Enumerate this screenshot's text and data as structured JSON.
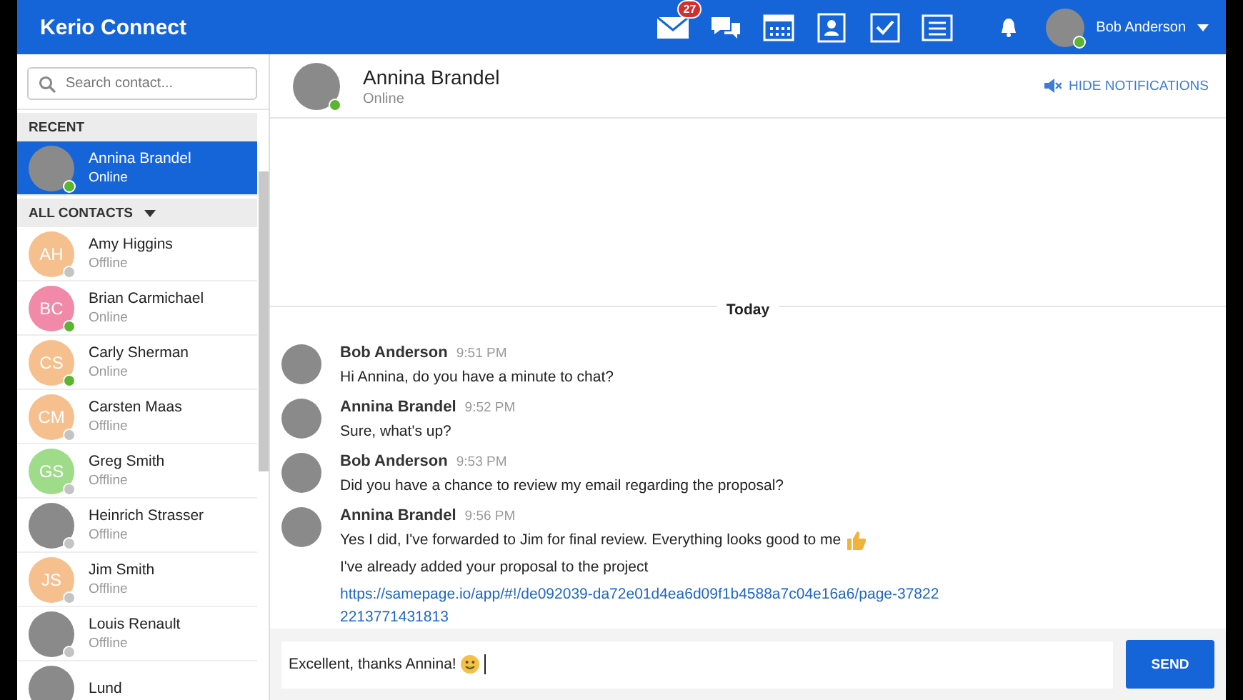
{
  "app_bar": {
    "title": "Kerio Connect",
    "nav": [
      {
        "kind": "mail",
        "badge": "27"
      },
      {
        "kind": "chat"
      },
      {
        "kind": "calendar"
      },
      {
        "kind": "contacts"
      },
      {
        "kind": "tasks"
      },
      {
        "kind": "notes"
      }
    ],
    "user": {
      "name": "Bob Anderson",
      "online": true
    }
  },
  "sidebar": {
    "search": {
      "placeholder": "Search contact..."
    },
    "sections": [
      {
        "title": "RECENT",
        "dropdown": false,
        "contacts": [
          {
            "name": "Annina Brandel",
            "status": "Online",
            "online": true,
            "selected": true
          }
        ]
      },
      {
        "title": "ALL CONTACTS",
        "dropdown": true,
        "contacts": [
          {
            "name": "Amy Higgins",
            "status": "Offline",
            "online": false,
            "selected": false,
            "initials": "AH",
            "color": "#f5c08e"
          },
          {
            "name": "Brian Carmichael",
            "status": "Online",
            "online": true,
            "selected": false,
            "initials": "BC",
            "color": "#f08aa8"
          },
          {
            "name": "Carly Sherman",
            "status": "Online",
            "online": true,
            "selected": false,
            "initials": "CS",
            "color": "#f5c08e"
          },
          {
            "name": "Carsten Maas",
            "status": "Offline",
            "online": false,
            "selected": false,
            "initials": "CM",
            "color": "#f5c08e"
          },
          {
            "name": "Greg Smith",
            "status": "Offline",
            "online": false,
            "selected": false,
            "initials": "GS",
            "color": "#9fdc8a"
          },
          {
            "name": "Heinrich Strasser",
            "status": "Offline",
            "online": false,
            "selected": false
          },
          {
            "name": "Jim Smith",
            "status": "Offline",
            "online": false,
            "selected": false,
            "initials": "JS",
            "color": "#f5c08e"
          },
          {
            "name": "Louis Renault",
            "status": "Offline",
            "online": false,
            "selected": false
          },
          {
            "name": "Lund",
            "selected": false
          }
        ]
      }
    ]
  },
  "chat": {
    "contact": {
      "name": "Annina Brandel",
      "status": "Online",
      "online": true
    },
    "hide_notifications": "HIDE NOTIFICATIONS",
    "day": "Today",
    "messages": [
      {
        "author": "Bob Anderson",
        "time": "9:51 PM",
        "lines": [
          {
            "text": "Hi Annina, do you have a minute to chat?"
          }
        ]
      },
      {
        "author": "Annina Brandel",
        "time": "9:52 PM",
        "lines": [
          {
            "text": "Sure, what's up?"
          }
        ]
      },
      {
        "author": "Bob Anderson",
        "time": "9:53 PM",
        "lines": [
          {
            "text": "Did you have a chance to review my email regarding the proposal?"
          }
        ]
      },
      {
        "author": "Annina Brandel",
        "time": "9:56 PM",
        "lines": [
          {
            "kind": "with_icon",
            "text": "Yes I did, I've forwarded to Jim for final review. Everything looks good to me"
          },
          {
            "text": "I've already added your proposal to the project ",
            "link": "https://samepage.io/app/#!/de092039-da72e01d4ea6d09f1b4588a7c04e16a6/page-378222213771431813"
          }
        ]
      }
    ],
    "composer": {
      "value": "Excellent, thanks Annina!",
      "send": "SEND"
    }
  }
}
